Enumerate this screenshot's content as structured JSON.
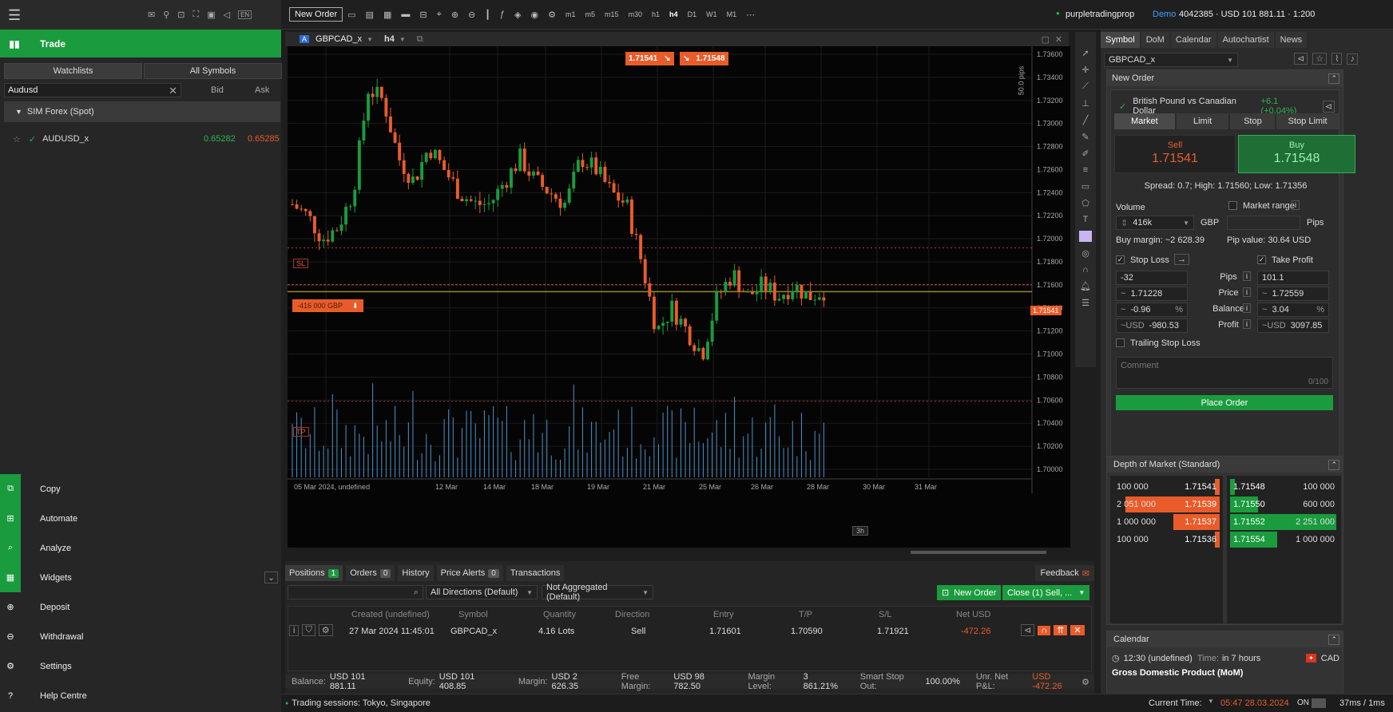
{
  "top": {
    "new_order": "New Order",
    "timeframes": [
      "m1",
      "m5",
      "m15",
      "m30",
      "h1",
      "h4",
      "D1",
      "W1",
      "M1"
    ],
    "account_name": "purpletradingprop",
    "account_mode": "Demo",
    "account_info": "4042385 · USD 101 881.11 · 1:200",
    "lang": "EN"
  },
  "left": {
    "trade_label": "Trade",
    "tabs": [
      "Watchlists",
      "All Symbols"
    ],
    "search_value": "Audusd",
    "col_bid": "Bid",
    "col_ask": "Ask",
    "group": "SIM Forex (Spot)",
    "rows": [
      {
        "symbol": "AUDUSD_x",
        "bid": "0.65282",
        "ask": "0.65285"
      }
    ],
    "menu": [
      "Copy",
      "Automate",
      "Analyze",
      "Widgets",
      "Deposit",
      "Withdrawal",
      "Settings",
      "Help Centre"
    ]
  },
  "chart": {
    "symbol": "GBPCAD_x",
    "badge": "A",
    "timeframe": "h4",
    "bid_tag": "1.71541",
    "ask_tag": "1.71548",
    "pips_label": "50.0 pips",
    "sl_label": "SL",
    "tp_label": "TP",
    "position_label": "-416 000 GBP",
    "price_tag": "1.71541",
    "countdown": "3h",
    "y_ticks": [
      "1.73600",
      "1.73400",
      "1.73200",
      "1.73000",
      "1.72800",
      "1.72600",
      "1.72400",
      "1.72200",
      "1.72000",
      "1.71800",
      "1.71600",
      "1.71400",
      "1.71200",
      "1.71000",
      "1.70800",
      "1.70600",
      "1.70400",
      "1.70200",
      "1.70000"
    ],
    "x_ticks": [
      "05 Mar 2024, undefined",
      "12 Mar",
      "14 Mar",
      "18 Mar",
      "19 Mar",
      "21 Mar",
      "25 Mar",
      "26 Mar",
      "28 Mar",
      "30 Mar",
      "31 Mar"
    ]
  },
  "right": {
    "tabs": [
      "Symbol",
      "DoM",
      "Calendar",
      "Autochartist",
      "News"
    ],
    "symbol_select": "GBPCAD_x",
    "new_order_title": "New Order",
    "instrument": "British Pound vs Canadian Dollar",
    "change": "+6.1 (+0.04%)",
    "order_types": [
      "Market",
      "Limit",
      "Stop",
      "Stop Limit"
    ],
    "sell_label": "Sell",
    "sell_price": "1.71541",
    "buy_label": "Buy",
    "buy_price": "1.71548",
    "spread": "Spread: 0.7; High: 1.71560; Low: 1.71356",
    "volume_label": "Volume",
    "volume_value": "416k",
    "volume_ccy": "GBP",
    "market_range": "Market range",
    "pips_unit": "Pips",
    "buy_margin": "Buy margin: ~2 628.39",
    "pip_value": "Pip value: 30.64 USD",
    "stop_loss": "Stop Loss",
    "take_profit": "Take Profit",
    "row_labels": [
      "Pips",
      "Price",
      "Balance",
      "Profit"
    ],
    "sl_values": [
      "-32",
      "1.71228",
      "-0.96",
      "-980.53"
    ],
    "tp_values": [
      "101.1",
      "1.72559",
      "3.04",
      "3097.85"
    ],
    "pct": "%",
    "usd_prefix": "~USD",
    "approx": "~",
    "trailing": "Trailing Stop Loss",
    "comment_placeholder": "Comment",
    "comment_count": "0/100",
    "place_order": "Place Order",
    "dom_title": "Depth of Market (Standard)",
    "dom_bids": [
      {
        "vol": "100 000",
        "price": "1.71541"
      },
      {
        "vol": "2 051 000",
        "price": "1.71539"
      },
      {
        "vol": "1 000 000",
        "price": "1.71537"
      },
      {
        "vol": "100 000",
        "price": "1.71536"
      }
    ],
    "dom_asks": [
      {
        "price": "1.71548",
        "vol": "100 000"
      },
      {
        "price": "1.71550",
        "vol": "600 000"
      },
      {
        "price": "1.71552",
        "vol": "2 251 000"
      },
      {
        "price": "1.71554",
        "vol": "1 000 000"
      }
    ],
    "calendar_title": "Calendar",
    "cal_time": "12:30 (undefined)",
    "cal_in": "Time:",
    "cal_in_val": "in 7 hours",
    "cal_ccy": "CAD",
    "cal_event": "Gross Domestic Product (MoM)"
  },
  "bottom": {
    "tabs": [
      {
        "label": "Positions",
        "count": "1"
      },
      {
        "label": "Orders",
        "count": "0"
      },
      {
        "label": "History",
        "count": ""
      },
      {
        "label": "Price Alerts",
        "count": "0"
      },
      {
        "label": "Transactions",
        "count": ""
      }
    ],
    "feedback": "Feedback",
    "directions": "All Directions (Default)",
    "aggregation": "Not Aggregated (Default)",
    "new_order": "New Order",
    "close_btn": "Close (1) Sell, ...",
    "headers": [
      "Created (undefined)",
      "Symbol",
      "Quantity",
      "Direction",
      "Entry",
      "T/P",
      "S/L",
      "Net USD"
    ],
    "row": [
      "27 Mar 2024 11:45:01",
      "GBPCAD_x",
      "4.16 Lots",
      "Sell",
      "1.71601",
      "1.70590",
      "1.71921",
      "-472.26"
    ],
    "balance": "Balance:",
    "balance_v": "USD 101 881.11",
    "equity": "Equity:",
    "equity_v": "USD 101 408.85",
    "margin": "Margin:",
    "margin_v": "USD 2 626.35",
    "free": "Free Margin:",
    "free_v": "USD 98 782.50",
    "level": "Margin Level:",
    "level_v": "3 861.21%",
    "sso": "Smart Stop Out:",
    "sso_v": "100.00%",
    "pnl": "Unr. Net P&L:",
    "pnl_v": "USD -472.26"
  },
  "status": {
    "sessions": "Trading sessions: Tokyo, Singapore",
    "current_time": "Current Time:",
    "time_value": "05:47 28.03.2024",
    "on": "ON",
    "latency": "37ms / 1ms"
  }
}
